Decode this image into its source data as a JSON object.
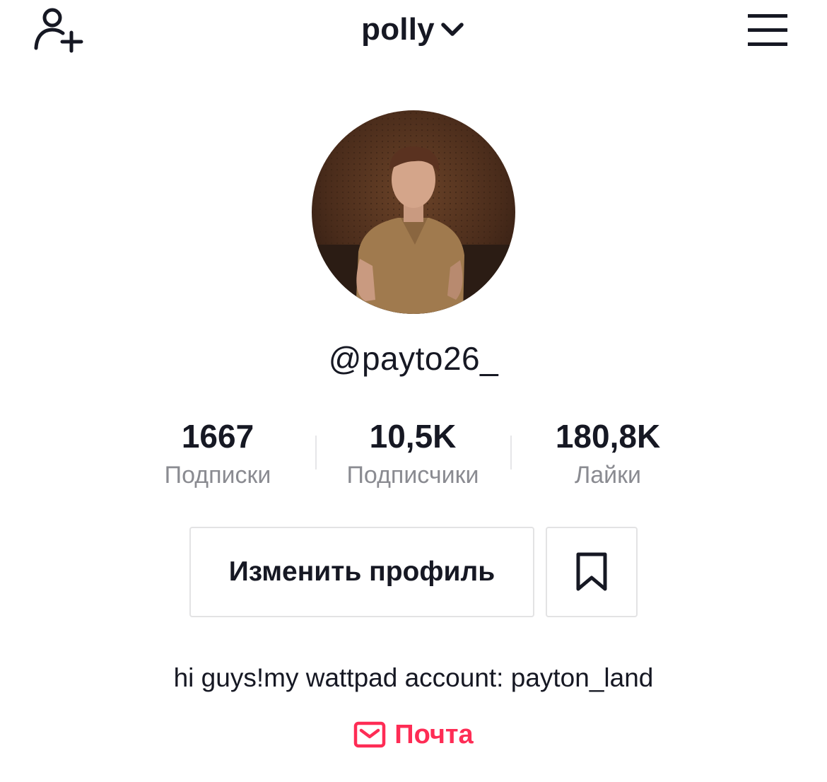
{
  "header": {
    "title": "polly",
    "add_user_icon": "add-user-icon",
    "dropdown_icon": "chevron-down-icon",
    "menu_icon": "hamburger-menu-icon"
  },
  "profile": {
    "avatar_icon": "profile-photo",
    "username": "@payto26_"
  },
  "stats": [
    {
      "value": "1667",
      "label": "Подписки"
    },
    {
      "value": "10,5K",
      "label": "Подписчики"
    },
    {
      "value": "180,8K",
      "label": "Лайки"
    }
  ],
  "actions": {
    "edit_profile_label": "Изменить профиль",
    "bookmark_icon": "bookmark-icon"
  },
  "bio": "hi guys!my wattpad account: payton_land",
  "email": {
    "label": "Почта",
    "icon": "mail-icon",
    "color": "#fe2c55"
  },
  "colors": {
    "text": "#161823",
    "secondary_text": "#8a8b91",
    "border": "#e3e3e4",
    "accent": "#fe2c55"
  }
}
